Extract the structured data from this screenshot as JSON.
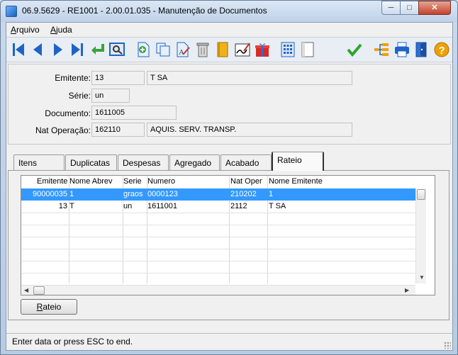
{
  "window": {
    "title": "06.9.5629 - RE1001 - 2.00.01.035 - Manutenção de Documentos",
    "min_label": "─",
    "max_label": "□",
    "close_label": "✕"
  },
  "menu": {
    "arquivo": "Arquivo",
    "ajuda": "Ajuda"
  },
  "toolbar": {
    "icons": [
      "first-icon",
      "previous-icon",
      "next-icon",
      "last-icon",
      "goto-icon",
      "search-icon",
      "new-icon",
      "copy-icon",
      "edit-icon",
      "delete-icon",
      "book-icon",
      "sign-icon",
      "gift-icon",
      "calculator-icon",
      "blank-page-icon",
      "confirm-icon",
      "tree-icon",
      "print-icon",
      "exit-icon",
      "help-icon"
    ]
  },
  "header": {
    "emitente_label": "Emitente:",
    "emitente_code": "13",
    "emitente_name": "T SA",
    "serie_label": "Série:",
    "serie_value": "un",
    "documento_label": "Documento:",
    "documento_value": "1611005",
    "natop_label": "Nat Operação:",
    "natop_code": "162110",
    "natop_desc": "AQUIS. SERV. TRANSP."
  },
  "tabs": [
    "Itens",
    "Duplicatas",
    "Despesas",
    "Agregado",
    "Acabado",
    "Rateio"
  ],
  "active_tab": "Rateio",
  "grid": {
    "columns": [
      "Emitente",
      "Nome Abrev",
      "Serie",
      "Numero",
      "Nat Oper",
      "Nome Emitente"
    ],
    "rows": [
      [
        "90000035",
        "1",
        "graos",
        "0000123",
        "210202",
        "1"
      ],
      [
        "13",
        "T",
        "un",
        "1611001",
        "2112",
        "T SA"
      ]
    ],
    "selected_row": 0
  },
  "rateio_button": "Rateio",
  "status": "Enter data or press ESC to end.",
  "colors": {
    "selection": "#3399ff",
    "accent_blue": "#1e64c8",
    "confirm_green": "#2ea52e",
    "help_orange": "#f0a000"
  }
}
